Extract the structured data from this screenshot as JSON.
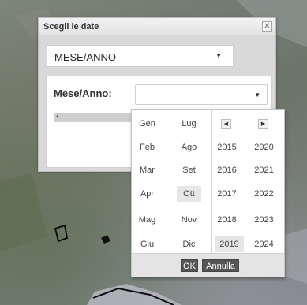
{
  "dialog": {
    "title": "Scegli le date",
    "close_symbol": "✕",
    "period_select": {
      "value": "MESE/ANNO",
      "arrow": "▼"
    },
    "field_label": "Mese/Anno:",
    "month_input": {
      "value": "",
      "arrow": "▼"
    },
    "scroll_left": "‹"
  },
  "picker": {
    "months_col1": [
      "Gen",
      "Feb",
      "Mar",
      "Apr",
      "Mag",
      "Giu"
    ],
    "months_col2": [
      "Lug",
      "Ago",
      "Set",
      "Ott",
      "Nov",
      "Dic"
    ],
    "years_col1": [
      "2015",
      "2016",
      "2017",
      "2018",
      "2019"
    ],
    "years_col2": [
      "2020",
      "2021",
      "2022",
      "2023",
      "2024"
    ],
    "selected_month": "Ott",
    "selected_year": "2019",
    "prev_symbol": "◀",
    "next_symbol": "▶",
    "ok_label": "OK",
    "cancel_label": "Annulla"
  },
  "icons": {
    "close": "close-icon",
    "dropdown": "chevron-down-icon",
    "prev": "chevron-left-icon",
    "next": "chevron-right-icon"
  }
}
